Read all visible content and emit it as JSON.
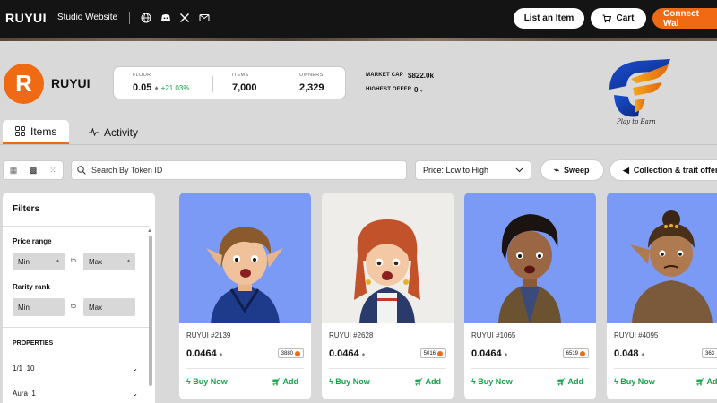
{
  "nav": {
    "brand": "RUYUI",
    "studio_link": "Studio Website",
    "icons": [
      "globe-icon",
      "discord-icon",
      "x-icon",
      "mail-icon"
    ],
    "list_item_label": "List an Item",
    "cart_label": "Cart",
    "connect_label": "Connect Wal"
  },
  "collection": {
    "logo_letter": "R",
    "name": "RUYUI",
    "floor_label": "FLOOR",
    "floor_value": "0.05",
    "floor_change": "+21.03%",
    "items_label": "ITEMS",
    "items_value": "7,000",
    "owners_label": "OWNERS",
    "owners_value": "2,329",
    "market_cap_label": "MARKET CAP",
    "market_cap_value": "$822.0k",
    "highest_offer_label": "HIGHEST OFFER",
    "highest_offer_value": "0",
    "badge_text": "Play to Earn"
  },
  "tabs": [
    {
      "label": "Items",
      "active": true
    },
    {
      "label": "Activity",
      "active": false
    }
  ],
  "toolbar": {
    "search_placeholder": "Search By Token ID",
    "sort_value": "Price: Low to High",
    "sweep_label": "Sweep",
    "offer_label": "Collection & trait offer"
  },
  "filters": {
    "title": "Filters",
    "price_range_label": "Price range",
    "price_min": "Min",
    "price_max": "Max",
    "to_label": "to",
    "rarity_label": "Rarity rank",
    "rarity_min": "Min",
    "rarity_max": "Max",
    "properties_label": "PROPERTIES",
    "properties": [
      {
        "name": "1/1",
        "count": "10"
      },
      {
        "name": "Aura",
        "count": "1"
      }
    ]
  },
  "cards": [
    {
      "name": "RUYUI #2139",
      "price": "0.0464",
      "rank": "3880",
      "bg": "#7b9af5"
    },
    {
      "name": "RUYUI #2628",
      "price": "0.0464",
      "rank": "5016",
      "bg": "#efedea"
    },
    {
      "name": "RUYUI #1065",
      "price": "0.0464",
      "rank": "6519",
      "bg": "#7b9af5"
    },
    {
      "name": "RUYUI #4095",
      "price": "0.048",
      "rank": "363",
      "bg": "#7b9af5"
    }
  ],
  "card_actions": {
    "buy": "Buy Now",
    "add": "Add"
  },
  "colors": {
    "accent": "#f06a14",
    "buy_green": "#16a34a",
    "nav_bg": "#141414"
  }
}
